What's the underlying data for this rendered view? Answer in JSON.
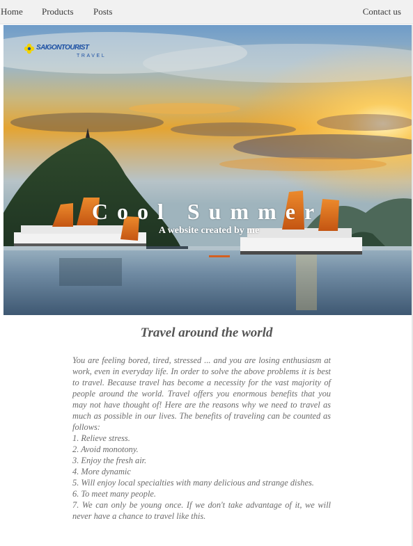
{
  "nav": {
    "home": "Home",
    "products": "Products",
    "posts": "Posts",
    "contact": "Contact us"
  },
  "hero": {
    "logo_text": "SAIGONTOURIST",
    "logo_sub": "TRAVEL",
    "title": "Cool Summer",
    "subtitle": "A website created by me"
  },
  "article": {
    "heading": "Travel around the world",
    "intro": "You are feeling bored, tired, stressed ... and you are losing enthusiasm at work, even in everyday life. In order to solve the above problems it is best to travel. Because travel has become a necessity for the vast majority of people around the world. Travel offers you enormous benefits that you may not have thought of! Here are the reasons why we need to travel as much as possible in our lives. The benefits of traveling can be counted as follows:",
    "items": [
      "1. Relieve stress.",
      "2. Avoid monotony.",
      "3. Enjoy the fresh air.",
      "4. More dynamic",
      "5. Will enjoy local specialties with many delicious and strange dishes.",
      "6. To meet many people.",
      "7. We can only be young once. If we don't take advantage of it, we will never have a chance to travel like this."
    ]
  },
  "colors": {
    "nav_bg": "#f1f1f1",
    "logo_blue": "#1b4fa3",
    "sail_orange": "#d9661a",
    "text_gray": "#6b6b6b"
  }
}
